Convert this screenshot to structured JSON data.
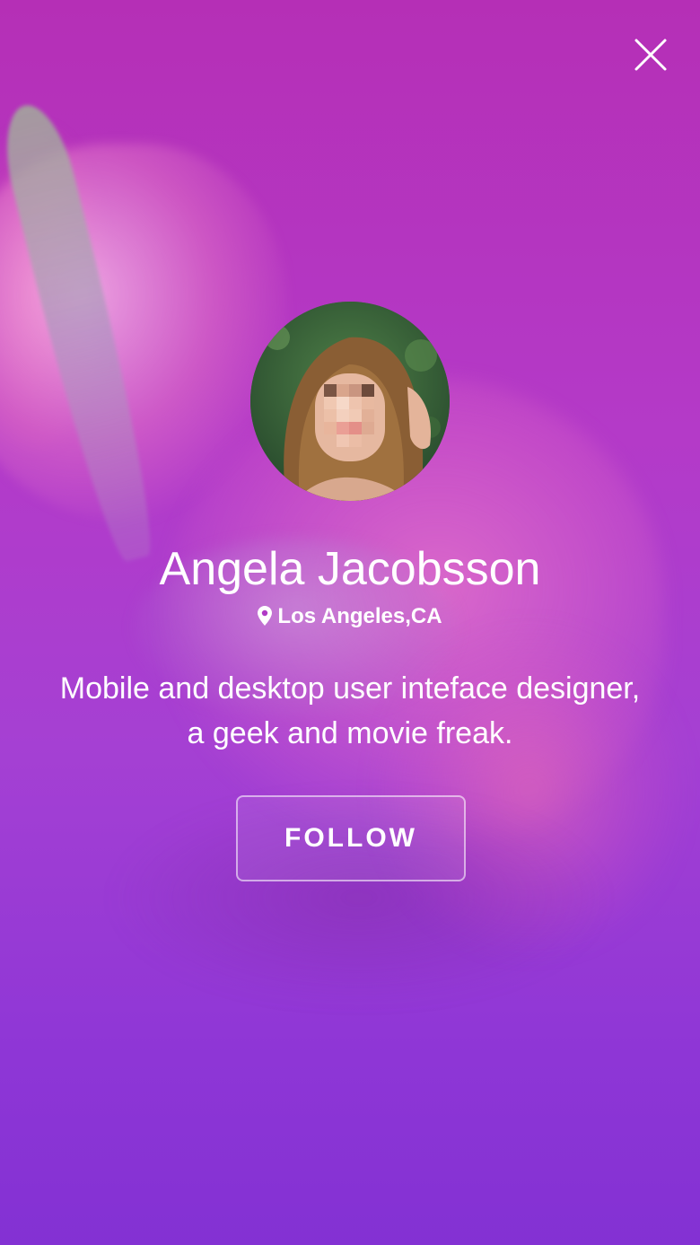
{
  "profile": {
    "name": "Angela Jacobsson",
    "location": "Los Angeles,CA",
    "bio_line1": "Mobile and desktop user inteface designer,",
    "bio_line2": "a geek and movie freak."
  },
  "actions": {
    "follow_label": "FOLLOW"
  },
  "icons": {
    "close": "close-icon",
    "location": "location-pin-icon"
  },
  "colors": {
    "background_top": "#b52fb6",
    "background_bottom": "#8331d3",
    "text": "#ffffff"
  }
}
